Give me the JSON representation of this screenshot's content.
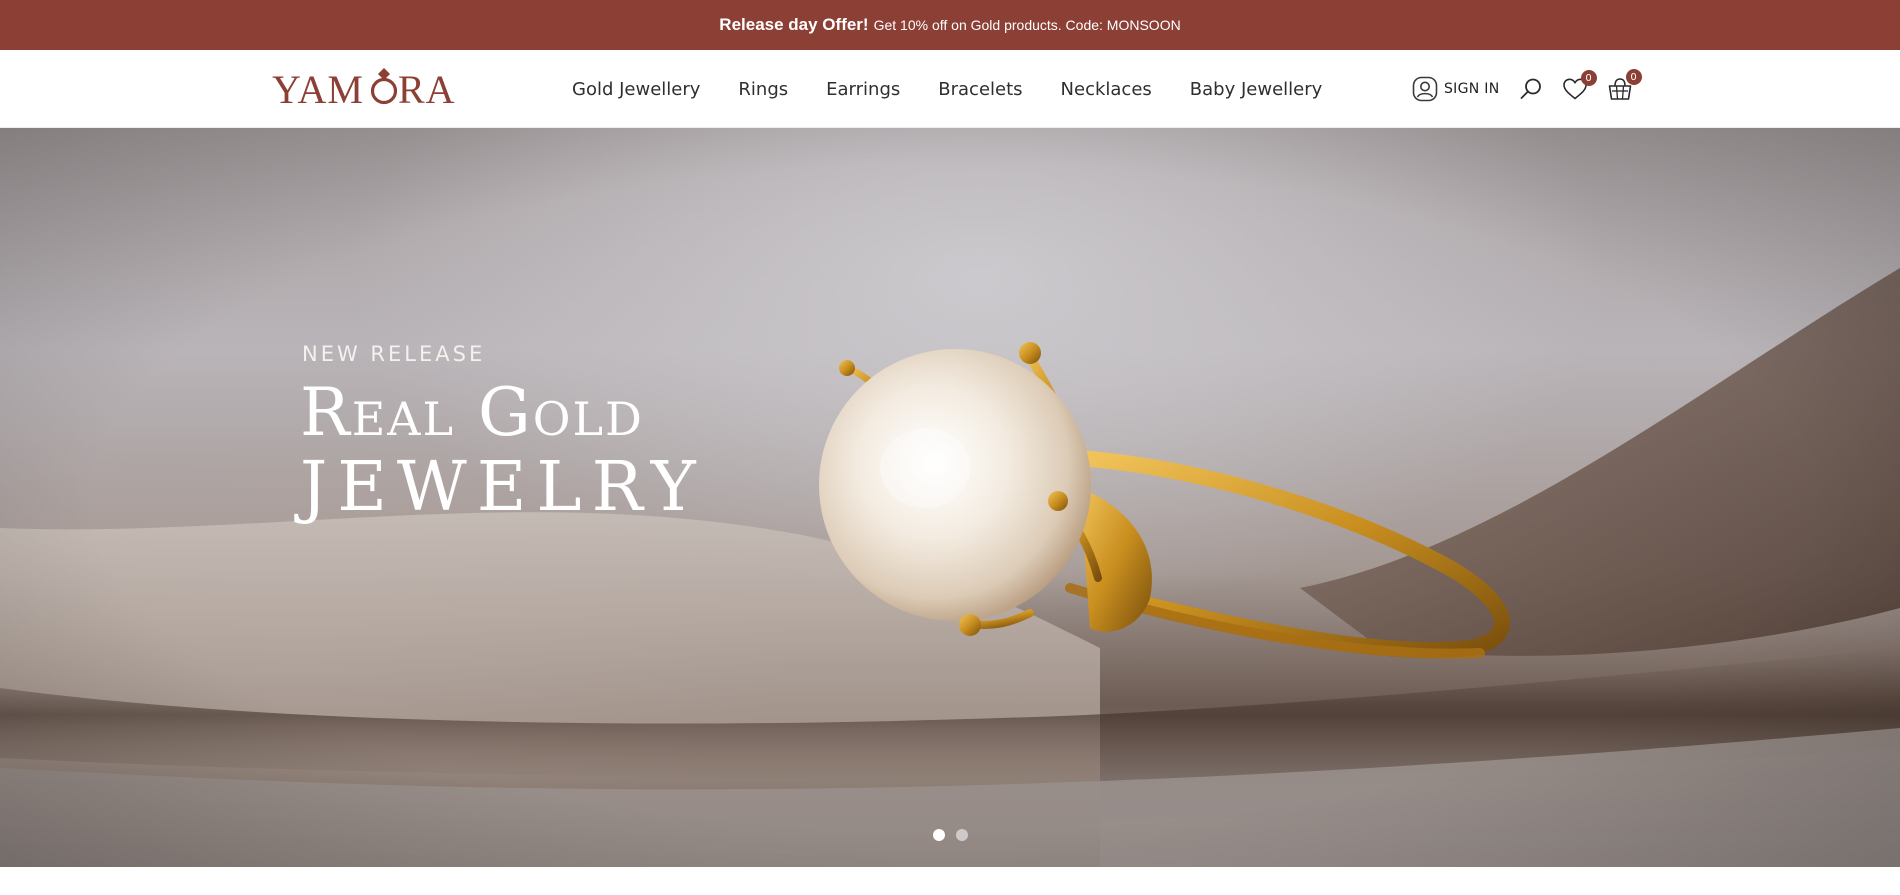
{
  "announcement": {
    "highlight": "Release day Offer!",
    "text": "Get 10% off on Gold products. Code: MONSOON"
  },
  "brand": {
    "name": "YAMORA",
    "color": "#8c3f35"
  },
  "nav": {
    "items": [
      {
        "label": "Gold Jewellery"
      },
      {
        "label": "Rings"
      },
      {
        "label": "Earrings"
      },
      {
        "label": "Bracelets"
      },
      {
        "label": "Necklaces"
      },
      {
        "label": "Baby Jewellery"
      }
    ]
  },
  "actions": {
    "sign_in": "SIGN IN",
    "wishlist_count": "0",
    "cart_count": "0",
    "icons": [
      "user-icon",
      "search-icon",
      "heart-icon",
      "basket-icon"
    ]
  },
  "hero": {
    "eyebrow": "NEW RELEASE",
    "title_line1": "Real Gold",
    "title_line2": "JEWELRY",
    "slides_total": 2,
    "active_slide": 1
  }
}
